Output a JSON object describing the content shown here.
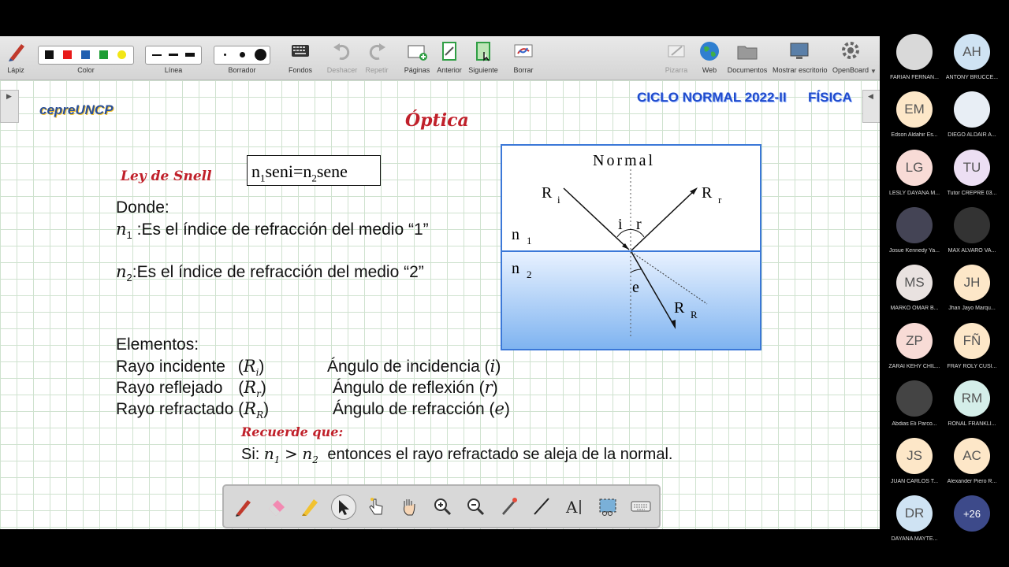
{
  "toolbar": {
    "pencil": "Lápiz",
    "color": "Color",
    "line": "Línea",
    "eraser": "Borrador",
    "backgrounds": "Fondos",
    "undo": "Deshacer",
    "redo": "Repetir",
    "pages": "Páginas",
    "previous": "Anterior",
    "next": "Siguiente",
    "clear": "Borrar",
    "board": "Pizarra",
    "web": "Web",
    "documents": "Documentos",
    "show_desktop": "Mostrar escritorio",
    "openboard": "OpenBoard",
    "colors": [
      "#111111",
      "#e81a1a",
      "#1f5fb0",
      "#1e9e35",
      "#f2e616"
    ]
  },
  "slide": {
    "logo_text": "cepreUNCP",
    "header": "CICLO NORMAL  2022-II",
    "subject": "FÍSICA",
    "title": "Óptica",
    "snell_label": "Ley de Snell",
    "formula": {
      "n1": "n",
      "s1": "1",
      "mid": "seni=n",
      "s2": "2",
      "end": "sene"
    },
    "where": "Donde:",
    "n1_text": ":Es el índice de refracción del medio “1”",
    "n2_text": ":Es el índice de refracción del medio “2”",
    "elements_title": "Elementos:",
    "rows": [
      {
        "ray": "Rayo incidente",
        "ray_symbol": "R",
        "ray_sub": "i",
        "angle": "Ángulo de incidencia",
        "angle_symbol": "i"
      },
      {
        "ray": "Rayo reflejado",
        "ray_symbol": "R",
        "ray_sub": "r",
        "angle": "Ángulo de reflexión",
        "angle_symbol": "r"
      },
      {
        "ray": "Rayo refractado",
        "ray_symbol": "R",
        "ray_sub": "R",
        "angle": "Ángulo de refracción",
        "angle_symbol": "e"
      }
    ],
    "remember_label": "Recuerde que:",
    "remember_prefix": "Si:",
    "remember_suffix": "entonces el rayo refractado se aleja de la normal.",
    "diagram": {
      "normal": "Normal",
      "ri": "R",
      "ri_sub": "i",
      "rr": "R",
      "rr_sub": "r",
      "rR": "R",
      "rR_sub": "R",
      "n1": "n",
      "n1_sub": "1",
      "n2": "n",
      "n2_sub": "2",
      "i": "i",
      "r": "r",
      "e": "e"
    }
  },
  "participants": [
    {
      "initials": "",
      "name": "FARIAN FERNAN...",
      "bg": "#d9d9d9",
      "photo": true
    },
    {
      "initials": "AH",
      "name": "ANTONY BRUCCE...",
      "bg": "#cfe3f3"
    },
    {
      "initials": "EM",
      "name": "Edson Aldahir Es...",
      "bg": "#fde7c8"
    },
    {
      "initials": "",
      "name": "DIEGO ALDAIR A...",
      "bg": "#e8eef5",
      "photo": true
    },
    {
      "initials": "LG",
      "name": "LESLY DAYANA M...",
      "bg": "#f8dbd6"
    },
    {
      "initials": "TU",
      "name": "Tutor CREPRE 03...",
      "bg": "#ecdff3"
    },
    {
      "initials": "",
      "name": "Josue Kennedy Ya...",
      "bg": "#445",
      "photo": true
    },
    {
      "initials": "",
      "name": "MAX ALVARO VA...",
      "bg": "#333",
      "photo": true
    },
    {
      "initials": "MS",
      "name": "MARKO OMAR B...",
      "bg": "#e9e2e0"
    },
    {
      "initials": "JH",
      "name": "Jhan Jayo Marqu...",
      "bg": "#fde7c8"
    },
    {
      "initials": "ZP",
      "name": "ZARAI KEHY CHIL...",
      "bg": "#f8dbd6"
    },
    {
      "initials": "FÑ",
      "name": "FRAY ROLY CUSI...",
      "bg": "#fde7c8"
    },
    {
      "initials": "",
      "name": "Abdias Eli Parco...",
      "bg": "#444",
      "photo": true
    },
    {
      "initials": "RM",
      "name": "RONAL FRANKLI...",
      "bg": "#d4eee9"
    },
    {
      "initials": "JS",
      "name": "JUAN CARLOS T...",
      "bg": "#fde7c8"
    },
    {
      "initials": "AC",
      "name": "Alexander Piero R...",
      "bg": "#fde7c8"
    },
    {
      "initials": "DR",
      "name": "DAYANA MAYTE...",
      "bg": "#cfe3f3"
    },
    {
      "initials": "+26",
      "name": "",
      "bg": "#3d4a8a"
    }
  ]
}
